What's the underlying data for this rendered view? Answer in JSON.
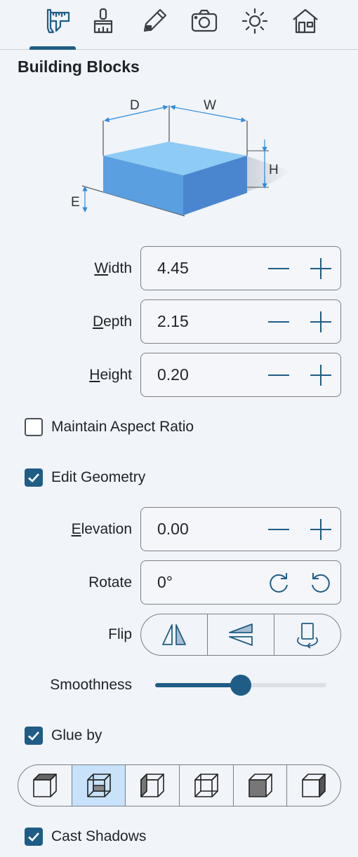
{
  "tabs": [
    {
      "name": "tab-measure",
      "icon": "ruler-caliper-icon",
      "selected": true
    },
    {
      "name": "tab-paint",
      "icon": "paint-brush-icon",
      "selected": false
    },
    {
      "name": "tab-edit",
      "icon": "pencil-eraser-icon",
      "selected": false
    },
    {
      "name": "tab-camera",
      "icon": "camera-icon",
      "selected": false
    },
    {
      "name": "tab-lighting",
      "icon": "sun-icon",
      "selected": false
    },
    {
      "name": "tab-house",
      "icon": "house-icon",
      "selected": false
    }
  ],
  "section_title": "Building Blocks",
  "diagram": {
    "depth_label": "D",
    "width_label": "W",
    "height_label": "H",
    "elevation_label": "E"
  },
  "fields": {
    "width": {
      "label_key": "W",
      "label_rest": "idth",
      "value": "4.45"
    },
    "depth": {
      "label_key": "D",
      "label_rest": "epth",
      "value": "2.15"
    },
    "height": {
      "label_key": "H",
      "label_rest": "eight",
      "value": "0.20"
    },
    "elevation": {
      "label_key": "E",
      "label_rest": "levation",
      "value": "0.00"
    },
    "rotate": {
      "label": "Rotate",
      "value": "0°"
    }
  },
  "checkboxes": {
    "maintain_aspect": {
      "label": "Maintain Aspect Ratio",
      "checked": false
    },
    "edit_geometry": {
      "label": "Edit Geometry",
      "checked": true
    },
    "glue_by": {
      "label": "Glue by",
      "checked": true
    },
    "cast_shadows": {
      "label": "Cast Shadows",
      "checked": true
    }
  },
  "flip": {
    "label": "Flip",
    "options": [
      "flip-horizontal-icon",
      "flip-vertical-icon",
      "flip-rotate-icon"
    ]
  },
  "smoothness": {
    "label": "Smoothness",
    "value": 0.5
  },
  "glue_options": {
    "selected_index": 1,
    "icons": [
      "glue-top-face-icon",
      "glue-front-face-icon",
      "glue-side-face-icon",
      "glue-back-face-icon",
      "glue-bottom-face-icon",
      "glue-all-faces-icon"
    ]
  },
  "colors": {
    "accent": "#1f5d86",
    "selected_segment": "#c7e2fa",
    "block_top": "#8ecbf5",
    "block_front": "#5a9fe0",
    "block_side": "#4a86cf"
  }
}
